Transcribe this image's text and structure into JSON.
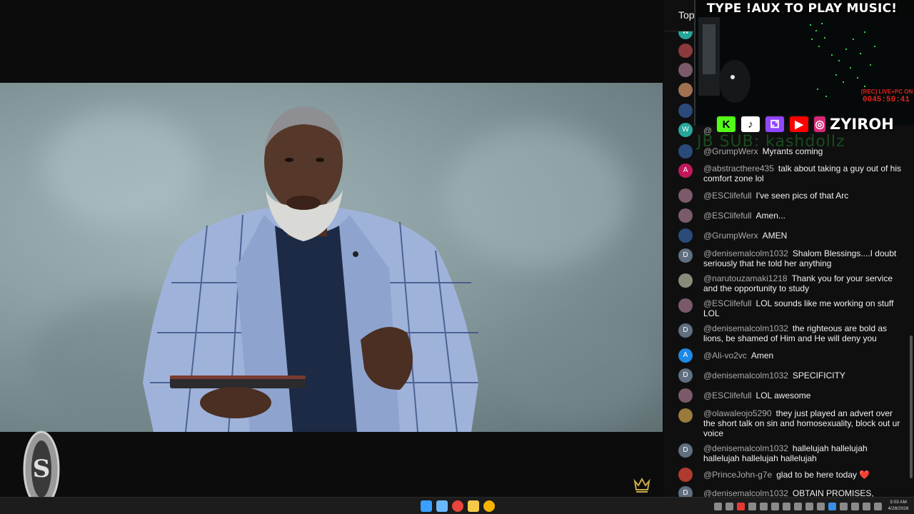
{
  "chat": {
    "header": "Top",
    "messages": [
      {
        "author": "@GrumpWerx",
        "text": "Myrants coming",
        "avatar": "globe-avatar",
        "avatar_letter": "",
        "avatar_color": "#2a4a7a"
      },
      {
        "author": "@abstracthere435",
        "text": "talk about taking a guy out of his comfort zone lol",
        "avatar": "letter-avatar",
        "avatar_letter": "A",
        "avatar_color": "#c2185b"
      },
      {
        "author": "@ESClifefull",
        "text": "I've seen pics of that Arc",
        "avatar": "photo-avatar",
        "avatar_letter": "",
        "avatar_color": "#7a5a6a"
      },
      {
        "author": "@ESClifefull",
        "text": "Amen...",
        "avatar": "photo-avatar",
        "avatar_letter": "",
        "avatar_color": "#7a5a6a"
      },
      {
        "author": "@GrumpWerx",
        "text": "AMEN",
        "avatar": "globe-avatar",
        "avatar_letter": "",
        "avatar_color": "#2a4a7a"
      },
      {
        "author": "@denisemalcolm1032",
        "text": "Shalom Blessings....I doubt seriously that he told her anything",
        "avatar": "letter-avatar",
        "avatar_letter": "D",
        "avatar_color": "#5f6f7f"
      },
      {
        "author": "@narutouzamaki1218",
        "text": "Thank you for your service and the opportunity to study",
        "avatar": "photo-avatar",
        "avatar_letter": "",
        "avatar_color": "#8a8a7a"
      },
      {
        "author": "@ESClifefull",
        "text": "LOL sounds like me working on stuff LOL",
        "avatar": "photo-avatar",
        "avatar_letter": "",
        "avatar_color": "#7a5a6a"
      },
      {
        "author": "@denisemalcolm1032",
        "text": "the righteous are bold as lions, be shamed of Him and He will deny you",
        "avatar": "letter-avatar",
        "avatar_letter": "D",
        "avatar_color": "#5f6f7f"
      },
      {
        "author": "@Ali-vo2vc",
        "text": "Amen",
        "avatar": "letter-avatar",
        "avatar_letter": "A",
        "avatar_color": "#1e88e5"
      },
      {
        "author": "@denisemalcolm1032",
        "text": "SPECIFICITY",
        "avatar": "letter-avatar",
        "avatar_letter": "D",
        "avatar_color": "#5f6f7f"
      },
      {
        "author": "@ESClifefull",
        "text": "LOL awesome",
        "avatar": "photo-avatar",
        "avatar_letter": "",
        "avatar_color": "#7a5a6a"
      },
      {
        "author": "@olawaleojo5290",
        "text": "they just played an advert over the short talk on sin and homosexuality, block out ur voice",
        "avatar": "photo-avatar",
        "avatar_letter": "",
        "avatar_color": "#9a7a3a"
      },
      {
        "author": "@denisemalcolm1032",
        "text": "hallelujah hallelujah hallelujah hallelujah hallelujah",
        "avatar": "letter-avatar",
        "avatar_letter": "D",
        "avatar_color": "#5f6f7f"
      },
      {
        "author": "@PrinceJohn-g7e",
        "text": "glad to be here today ❤️",
        "avatar": "photo-avatar",
        "avatar_letter": "",
        "avatar_color": "#b03a2e"
      },
      {
        "author": "@denisemalcolm1032",
        "text": "OBTAIN PROMISES,",
        "avatar": "letter-avatar",
        "avatar_letter": "D",
        "avatar_color": "#5f6f7f"
      }
    ],
    "hidden_avatars": [
      {
        "letter": "W",
        "color": "#26a69a"
      },
      {
        "letter": "",
        "color": "#8a3a3a"
      },
      {
        "letter": "",
        "color": "#7a5a6a"
      },
      {
        "letter": "",
        "color": "#a07050"
      },
      {
        "letter": "",
        "color": "#2a4a7a"
      },
      {
        "letter": "W",
        "color": "#26a69a"
      }
    ],
    "partial_author": "@"
  },
  "overlay": {
    "title": "TYPE !AUX TO PLAY MUSIC!",
    "live_label": "[REC] LIVE+PC ON",
    "timer": "0045:59:41",
    "social_icons": [
      {
        "name": "kick-icon",
        "glyph": "K",
        "bg": "#53fc18",
        "fg": "#000"
      },
      {
        "name": "tiktok-icon",
        "glyph": "♪",
        "bg": "#ffffff",
        "fg": "#000"
      },
      {
        "name": "twitch-icon",
        "glyph": "⚁",
        "bg": "#9146ff",
        "fg": "#fff"
      },
      {
        "name": "youtube-icon",
        "glyph": "▶",
        "bg": "#ff0000",
        "fg": "#fff"
      },
      {
        "name": "instagram-icon",
        "glyph": "◎",
        "bg": "#d62976",
        "fg": "#fff"
      }
    ],
    "handle": "ZYIROH",
    "ticker": "JB SUB: kashdollz"
  },
  "taskbar": {
    "apps": [
      {
        "name": "start-icon",
        "color": "#3aa0ff"
      },
      {
        "name": "task-view-icon",
        "color": "#6ab7ff"
      },
      {
        "name": "chrome-icon",
        "color": "#e8453c"
      },
      {
        "name": "file-explorer-icon",
        "color": "#f7c948"
      },
      {
        "name": "chrome-profile-icon",
        "color": "#f4b400"
      }
    ],
    "time": "3:03 AM",
    "date": "4/28/2026"
  }
}
